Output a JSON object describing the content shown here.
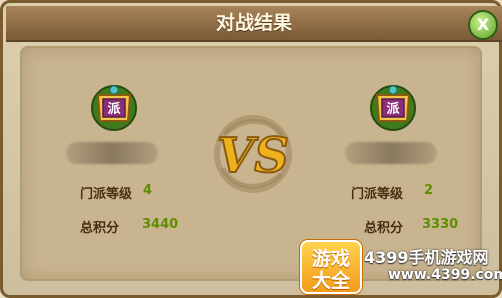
{
  "dialog": {
    "title": "对战结果",
    "close_label": "X"
  },
  "players": [
    {
      "emblem_char": "派",
      "stats": [
        {
          "label": "门派等级",
          "value": "4"
        },
        {
          "label": "总积分",
          "value": "3440"
        }
      ]
    },
    {
      "emblem_char": "派",
      "stats": [
        {
          "label": "门派等级",
          "value": "2"
        },
        {
          "label": "总积分",
          "value": "3330"
        }
      ]
    }
  ],
  "vs_label": "VS",
  "watermark": {
    "badge_line1": "游戏",
    "badge_line2": "大全",
    "site_name": "4399手机游戏网",
    "site_url": "www.4399.com"
  },
  "colors": {
    "title_bar": "#8b6a42",
    "panel": "#c8b48f",
    "stat_label": "#4a2d12",
    "stat_value": "#5e8e00",
    "vs_gold": "#f0b21c"
  }
}
